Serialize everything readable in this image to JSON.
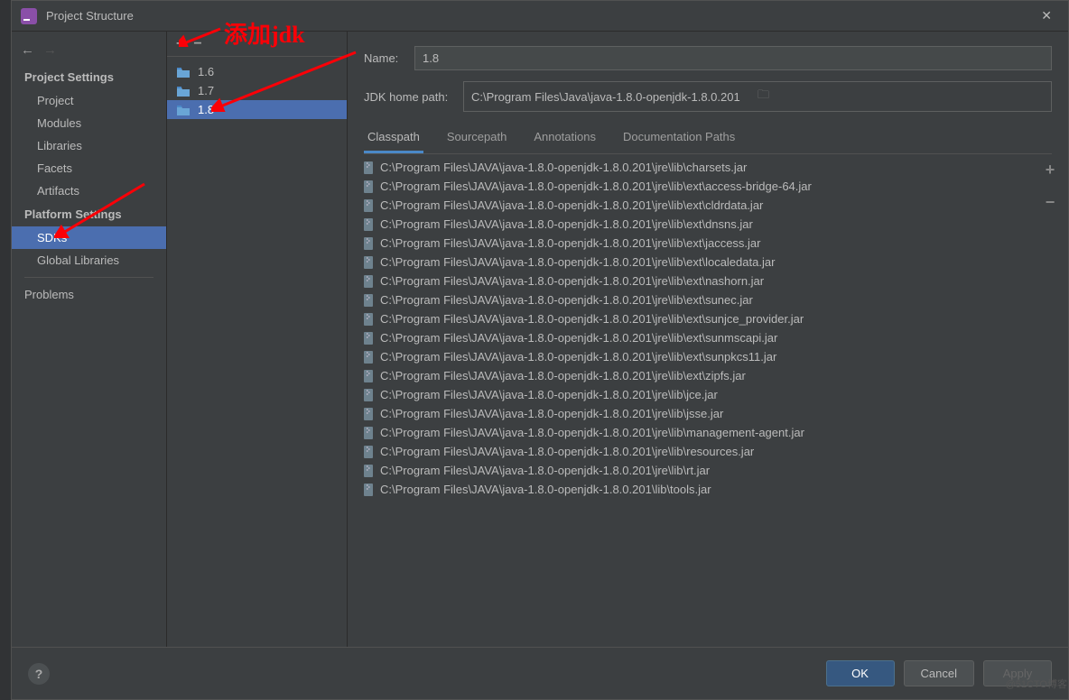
{
  "window": {
    "title": "Project Structure"
  },
  "sidebar": {
    "headings": {
      "project": "Project Settings",
      "platform": "Platform Settings"
    },
    "items": {
      "project": "Project",
      "modules": "Modules",
      "libraries": "Libraries",
      "facets": "Facets",
      "artifacts": "Artifacts",
      "sdks": "SDKs",
      "global": "Global Libraries",
      "problems": "Problems"
    }
  },
  "sdks": [
    {
      "name": "1.6"
    },
    {
      "name": "1.7"
    },
    {
      "name": "1.8"
    }
  ],
  "detail": {
    "name_label": "Name:",
    "name_value": "1.8",
    "home_label": "JDK home path:",
    "home_value": "C:\\Program Files\\Java\\java-1.8.0-openjdk-1.8.0.201",
    "tabs": {
      "classpath": "Classpath",
      "sourcepath": "Sourcepath",
      "annotations": "Annotations",
      "docs": "Documentation Paths"
    },
    "classpath": [
      "C:\\Program Files\\JAVA\\java-1.8.0-openjdk-1.8.0.201\\jre\\lib\\charsets.jar",
      "C:\\Program Files\\JAVA\\java-1.8.0-openjdk-1.8.0.201\\jre\\lib\\ext\\access-bridge-64.jar",
      "C:\\Program Files\\JAVA\\java-1.8.0-openjdk-1.8.0.201\\jre\\lib\\ext\\cldrdata.jar",
      "C:\\Program Files\\JAVA\\java-1.8.0-openjdk-1.8.0.201\\jre\\lib\\ext\\dnsns.jar",
      "C:\\Program Files\\JAVA\\java-1.8.0-openjdk-1.8.0.201\\jre\\lib\\ext\\jaccess.jar",
      "C:\\Program Files\\JAVA\\java-1.8.0-openjdk-1.8.0.201\\jre\\lib\\ext\\localedata.jar",
      "C:\\Program Files\\JAVA\\java-1.8.0-openjdk-1.8.0.201\\jre\\lib\\ext\\nashorn.jar",
      "C:\\Program Files\\JAVA\\java-1.8.0-openjdk-1.8.0.201\\jre\\lib\\ext\\sunec.jar",
      "C:\\Program Files\\JAVA\\java-1.8.0-openjdk-1.8.0.201\\jre\\lib\\ext\\sunjce_provider.jar",
      "C:\\Program Files\\JAVA\\java-1.8.0-openjdk-1.8.0.201\\jre\\lib\\ext\\sunmscapi.jar",
      "C:\\Program Files\\JAVA\\java-1.8.0-openjdk-1.8.0.201\\jre\\lib\\ext\\sunpkcs11.jar",
      "C:\\Program Files\\JAVA\\java-1.8.0-openjdk-1.8.0.201\\jre\\lib\\ext\\zipfs.jar",
      "C:\\Program Files\\JAVA\\java-1.8.0-openjdk-1.8.0.201\\jre\\lib\\jce.jar",
      "C:\\Program Files\\JAVA\\java-1.8.0-openjdk-1.8.0.201\\jre\\lib\\jsse.jar",
      "C:\\Program Files\\JAVA\\java-1.8.0-openjdk-1.8.0.201\\jre\\lib\\management-agent.jar",
      "C:\\Program Files\\JAVA\\java-1.8.0-openjdk-1.8.0.201\\jre\\lib\\resources.jar",
      "C:\\Program Files\\JAVA\\java-1.8.0-openjdk-1.8.0.201\\jre\\lib\\rt.jar",
      "C:\\Program Files\\JAVA\\java-1.8.0-openjdk-1.8.0.201\\lib\\tools.jar"
    ]
  },
  "footer": {
    "ok": "OK",
    "cancel": "Cancel",
    "apply": "Apply",
    "help": "?"
  },
  "annotation": {
    "text": "添加jdk"
  },
  "watermark": "@51CTO博客"
}
